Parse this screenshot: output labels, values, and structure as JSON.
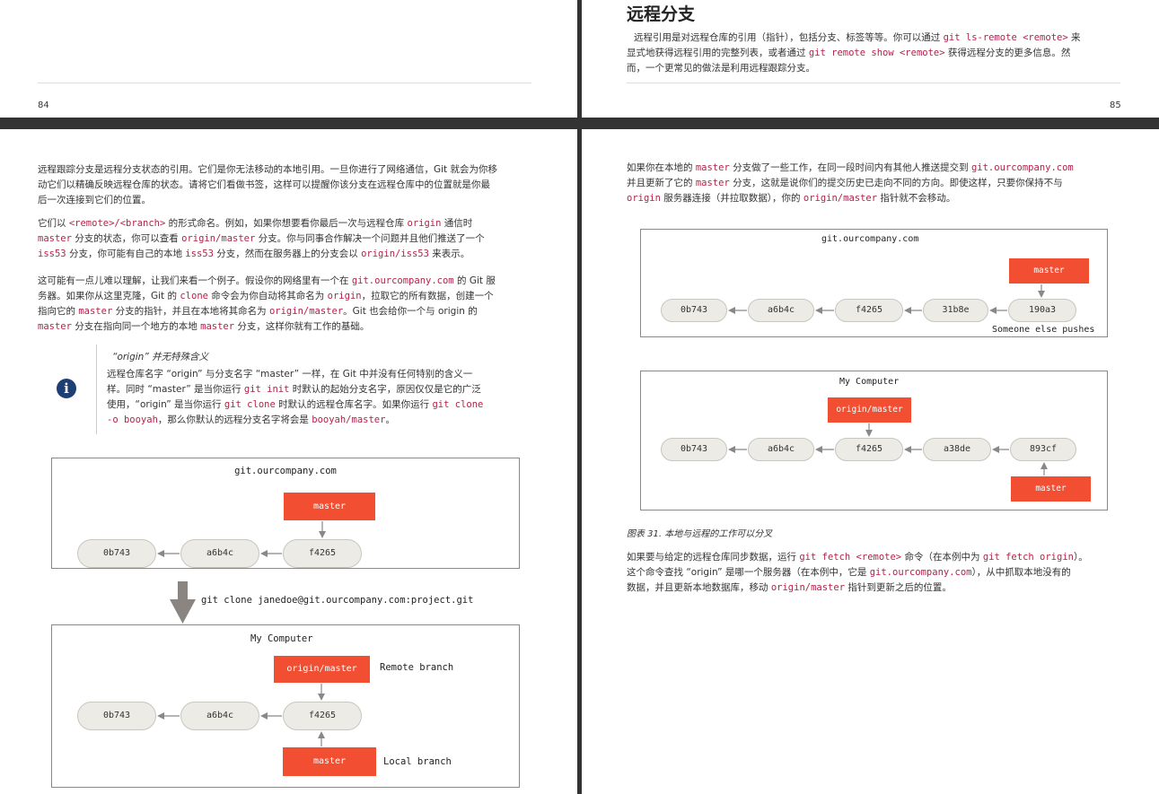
{
  "top_left": {
    "page_number": "84"
  },
  "top_right": {
    "heading": "远程分支",
    "para": [
      "远程引用是对远程仓库的引用（指针），包括分支、标签等等。你可以通过 ",
      "git ls-remote <remote>",
      " 来",
      "显式地获得远程引用的完整列表，或者通过 ",
      "git remote show <remote>",
      " 获得远程分支的更多信息。然",
      "而，一个更常见的做法是利用远程跟踪分支。"
    ],
    "page_number": "85"
  },
  "left": {
    "p1": [
      "远程跟踪分支是远程分支状态的引用。它们是你无法移动的本地引用。一旦你进行了网络通信，Git 就会为你移",
      "动它们以精确反映远程仓库的状态。请将它们看做书签，这样可以提醒你该分支在远程仓库中的位置就是你最",
      "后一次连接到它们的位置。"
    ],
    "p2": [
      "它们以 ",
      "<remote>/<branch>",
      " 的形式命名。例如，如果你想要看你最后一次与远程仓库 ",
      "origin",
      " 通信时",
      "master",
      " 分支的状态，你可以查看 ",
      "origin/master",
      " 分支。你与同事合作解决一个问题并且他们推送了一个",
      "iss53",
      " 分支，你可能有自己的本地 ",
      "iss53",
      " 分支，然而在服务器上的分支会以 ",
      "origin/iss53",
      " 来表示。"
    ],
    "p3": [
      "这可能有一点儿难以理解，让我们来看一个例子。假设你的网络里有一个在 ",
      "git.ourcompany.com",
      " 的 Git 服",
      "务器。如果你从这里克隆，Git 的 ",
      "clone",
      " 命令会为你自动将其命名为 ",
      "origin",
      "，拉取它的所有数据，创建一个",
      "指向它的 ",
      "master",
      " 分支的指针，并且在本地将其命名为 ",
      "origin/master",
      "。Git 也会给你一个与 origin 的",
      "master",
      " 分支在指向同一个地方的本地 ",
      "master",
      " 分支，这样你就有工作的基础。"
    ],
    "note": {
      "title": "“origin” 并无特殊含义",
      "icon": "info-icon",
      "body": [
        "远程仓库名字 “origin” 与分支名字 “master” 一样，在 Git 中并没有任何特别的含义一",
        "样。同时 “master” 是当你运行 ",
        "git init",
        " 时默认的起始分支名字，原因仅仅是它的广泛",
        "使用，“origin” 是当你运行 ",
        "git clone",
        " 时默认的远程仓库名字。如果你运行 ",
        "git clone",
        "-o booyah",
        "，那么你默认的远程分支名字将会是 ",
        "booyah/master",
        "。"
      ]
    },
    "diagram": {
      "server_title": "git.ourcompany.com",
      "server_ref": "master",
      "server_commits": [
        "0b743",
        "a6b4c",
        "f4265"
      ],
      "clone_cmd": "git clone janedoe@git.ourcompany.com:project.git",
      "local_title": "My Computer",
      "remote_ref": "origin/master",
      "remote_label": "Remote branch",
      "local_commits": [
        "0b743",
        "a6b4c",
        "f4265"
      ],
      "local_ref": "master",
      "local_label": "Local branch"
    }
  },
  "right": {
    "p1": [
      "如果你在本地的 ",
      "master",
      " 分支做了一些工作，在同一段时间内有其他人推送提交到 ",
      "git.ourcompany.com",
      "并且更新了它的 ",
      "master",
      " 分支，这就是说你们的提交历史已走向不同的方向。即使这样，只要你保持不与",
      "origin",
      " 服务器连接（并拉取数据），你的 ",
      "origin/master",
      " 指针就不会移动。"
    ],
    "diagram1": {
      "title": "git.ourcompany.com",
      "ref": "master",
      "commits": [
        "0b743",
        "a6b4c",
        "f4265",
        "31b8e",
        "190a3"
      ],
      "note": "Someone else pushes"
    },
    "diagram2": {
      "title": "My Computer",
      "remote_ref": "origin/master",
      "commits": [
        "0b743",
        "a6b4c",
        "f4265",
        "a38de",
        "893cf"
      ],
      "local_ref": "master"
    },
    "caption": "图表 31. 本地与远程的工作可以分叉",
    "p2": [
      "如果要与给定的远程仓库同步数据，运行 ",
      "git fetch <remote>",
      " 命令（在本例中为 ",
      "git fetch origin",
      "）。",
      "这个命令查找 “origin” 是哪一个服务器（在本例中，它是 ",
      "git.ourcompany.com",
      "），从中抓取本地没有的",
      "数据，并且更新本地数据库，移动 ",
      "origin/master",
      " 指针到更新之后的位置。"
    ]
  },
  "colors": {
    "ref_red": "#f14e32",
    "code_red": "#b22449",
    "commit_fill": "#ecebe5",
    "divider": "#333333",
    "info_blue": "#1d3f73"
  }
}
